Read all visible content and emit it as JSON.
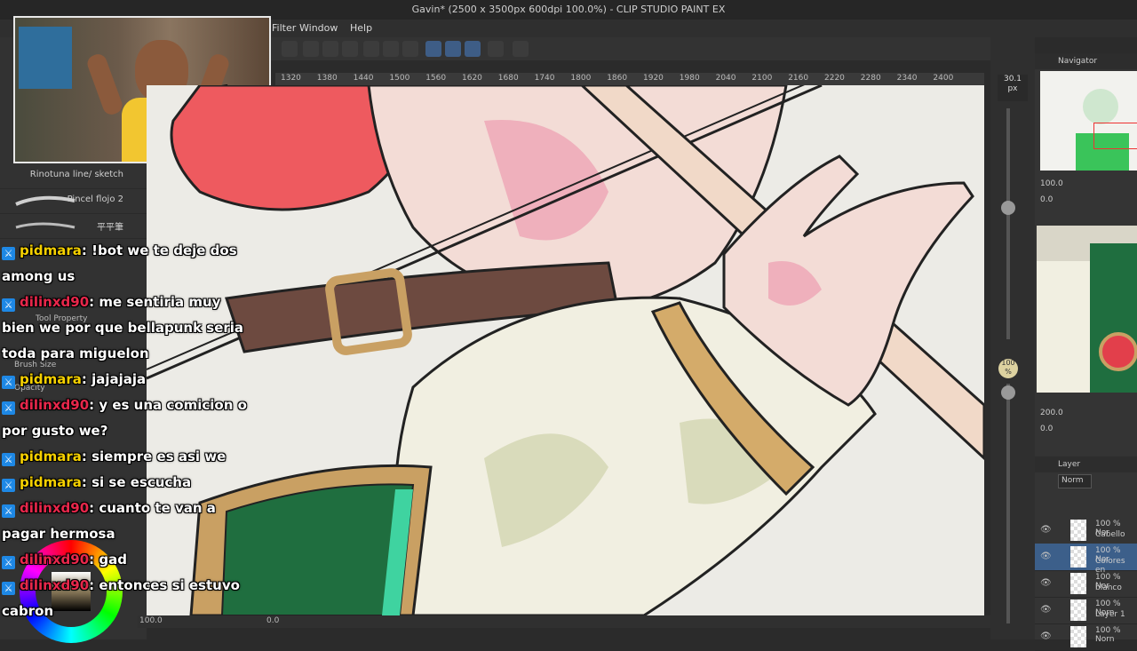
{
  "window": {
    "title": "Gavin* (2500 x 3500px 600dpi 100.0%) - CLIP STUDIO PAINT EX"
  },
  "menu": {
    "filter_label": "Filter",
    "window_label": "Window",
    "help_label": "Help"
  },
  "ruler": {
    "ticks": [
      "1320",
      "1380",
      "1440",
      "1500",
      "1560",
      "1620",
      "1680",
      "1740",
      "1800",
      "1860",
      "1920",
      "1980",
      "2040",
      "2100",
      "2160",
      "2220",
      "2280",
      "2340",
      "2400"
    ]
  },
  "brushes": {
    "items": [
      "Rinotuna line/ sketch",
      "Pincel flojo 2",
      "平平筆"
    ]
  },
  "tool_property": {
    "label": "Tool Property",
    "brush_size_label": "Brush Size",
    "opacity_label": "Opacity"
  },
  "chat": {
    "messages": [
      {
        "user": "pidmara",
        "text": ": !bot we te deje dos",
        "color": "#f5d000"
      },
      {
        "user": "",
        "text": "among us",
        "color": ""
      },
      {
        "user": "dilinxd90",
        "text": ": me sentiria muy",
        "color": "#e8274b"
      },
      {
        "user": "",
        "text": "bien we por que bellapunk seria",
        "color": ""
      },
      {
        "user": "",
        "text": "toda para miguelon",
        "color": ""
      },
      {
        "user": "pidmara",
        "text": ": jajajaja",
        "color": "#f5d000"
      },
      {
        "user": "dilinxd90",
        "text": ": y es una comicion o",
        "color": "#e8274b"
      },
      {
        "user": "",
        "text": "por gusto we?",
        "color": ""
      },
      {
        "user": "pidmara",
        "text": ": siempre es asi we",
        "color": "#f5d000"
      },
      {
        "user": "pidmara",
        "text": ": si se escucha",
        "color": "#f5d000"
      },
      {
        "user": "dilinxd90",
        "text": ": cuanto te van a",
        "color": "#e8274b"
      },
      {
        "user": "",
        "text": "pagar hermosa",
        "color": ""
      },
      {
        "user": "dilinxd90",
        "text": ": gad",
        "color": "#e8274b"
      },
      {
        "user": "dilinxd90",
        "text": ": entonces si estuvo",
        "color": "#e8274b"
      },
      {
        "user": "",
        "text": "cabron",
        "color": ""
      }
    ]
  },
  "zoom": {
    "brush_px": "30.1",
    "brush_unit": "px",
    "zoom_value": "100",
    "zoom_unit": "%"
  },
  "navigator": {
    "title": "Navigator",
    "zoom": "100.0",
    "angle": "0.0"
  },
  "subview": {
    "zoom": "200.0",
    "angle": "0.0"
  },
  "layer_panel": {
    "title": "Layer",
    "blend_mode": "Norm",
    "layers": [
      {
        "opacity": "100 % Nor",
        "name": "Cabello",
        "selected": false
      },
      {
        "opacity": "100 % Nor",
        "name": "Colores en",
        "selected": true
      },
      {
        "opacity": "100 % Nor",
        "name": "blanco",
        "selected": false
      },
      {
        "opacity": "100 % Norn",
        "name": "Layer 1",
        "selected": false
      },
      {
        "opacity": "100 % Norn",
        "name": "",
        "selected": false
      }
    ]
  },
  "status": {
    "zoom": "100.0",
    "angle": "0.0"
  },
  "colors": {
    "pidmara": "#f5d000",
    "dilinxd90": "#e8274b",
    "twitch_icon": "#1e88e5",
    "accent": "#3e5d86"
  }
}
